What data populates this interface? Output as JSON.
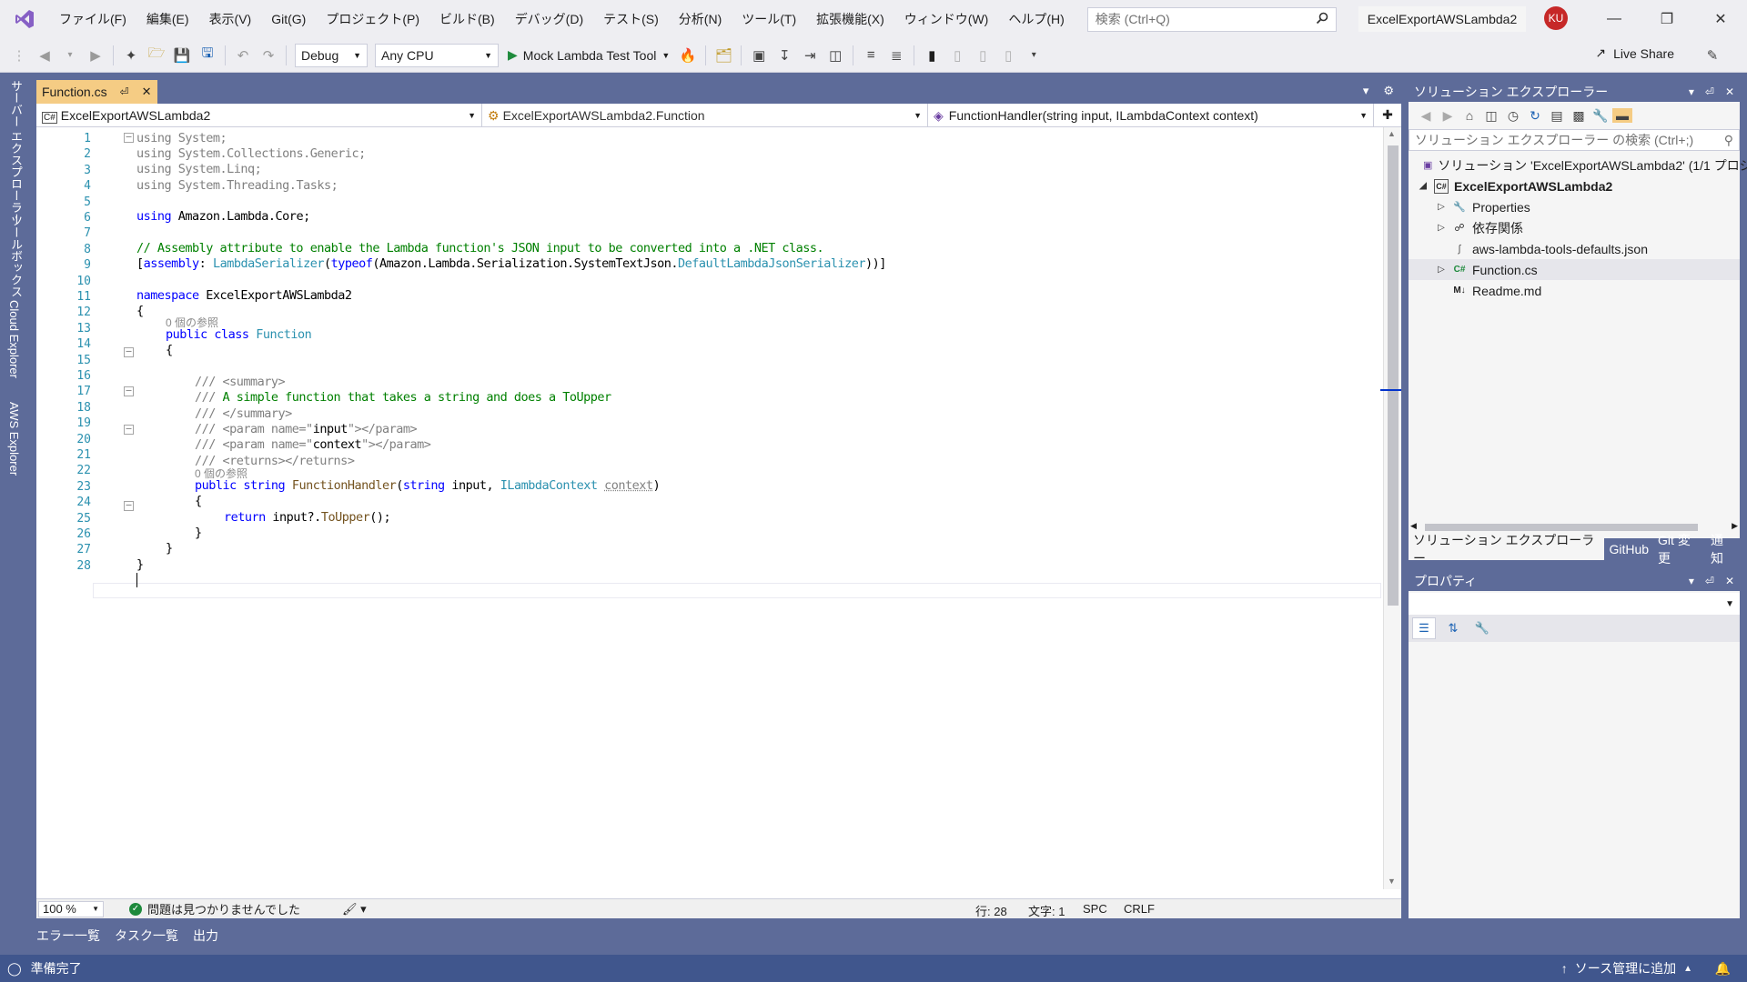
{
  "menu": {
    "items": [
      "ファイル(F)",
      "編集(E)",
      "表示(V)",
      "Git(G)",
      "プロジェクト(P)",
      "ビルド(B)",
      "デバッグ(D)",
      "テスト(S)",
      "分析(N)",
      "ツール(T)",
      "拡張機能(X)",
      "ウィンドウ(W)",
      "ヘルプ(H)"
    ],
    "search_placeholder": "検索 (Ctrl+Q)",
    "window_title": "ExcelExportAWSLambda2",
    "avatar_initials": "KU"
  },
  "toolbar": {
    "configuration": "Debug",
    "platform": "Any CPU",
    "run_target": "Mock Lambda Test Tool",
    "live_share": "Live Share"
  },
  "left_tabs": [
    "サーバー エクスプローラー",
    "ツールボックス",
    "Cloud Explorer",
    "AWS Explorer"
  ],
  "editor": {
    "tab_label": "Function.cs",
    "nav": {
      "project": "ExcelExportAWSLambda2",
      "type": "ExcelExportAWSLambda2.Function",
      "member": "FunctionHandler(string input, ILambdaContext context)"
    },
    "line_numbers": [
      "1",
      "2",
      "3",
      "4",
      "5",
      "6",
      "7",
      "8",
      "9",
      "10",
      "11",
      "12",
      "13",
      "14",
      "15",
      "16",
      "17",
      "18",
      "19",
      "20",
      "21",
      "22",
      "23",
      "24",
      "25",
      "26",
      "27",
      "28"
    ],
    "ref_hint_1": "0 個の参照",
    "ref_hint_2": "0 個の参照",
    "lines": {
      "l1a": "using",
      "l1b": " System;",
      "l2a": "using",
      "l2b": " System.Collections.Generic;",
      "l3a": "using",
      "l3b": " System.Linq;",
      "l4a": "using",
      "l4b": " System.Threading.Tasks;",
      "l6a": "using",
      "l6b": " Amazon.Lambda.Core;",
      "l8": "// Assembly attribute to enable the Lambda function's JSON input to be converted into a .NET class.",
      "l9a": "[",
      "l9b": "assembly",
      "l9c": ": ",
      "l9d": "LambdaSerializer",
      "l9e": "(",
      "l9f": "typeof",
      "l9g": "(Amazon.Lambda.Serialization.SystemTextJson.",
      "l9h": "DefaultLambdaJsonSerializer",
      "l9i": "))]",
      "l11a": "namespace",
      "l11b": " ExcelExportAWSLambda2",
      "l12": "{",
      "l13a": "public",
      "l13b": " ",
      "l13c": "class",
      "l13d": " ",
      "l13e": "Function",
      "l14": "{",
      "l16a": "/// ",
      "l16b": "<summary>",
      "l17a": "/// ",
      "l17b": "A simple function that takes a string and does a ToUpper",
      "l18a": "/// ",
      "l18b": "</summary>",
      "l19a": "/// ",
      "l19b": "<param name=\"",
      "l19c": "input",
      "l19d": "\"></param>",
      "l20a": "/// ",
      "l20b": "<param name=\"",
      "l20c": "context",
      "l20d": "\"></param>",
      "l21a": "/// ",
      "l21b": "<returns></returns>",
      "l22a": "public",
      "l22b": " ",
      "l22c": "string",
      "l22d": " ",
      "l22e": "FunctionHandler",
      "l22f": "(",
      "l22g": "string",
      "l22h": " input, ",
      "l22i": "ILambdaContext",
      "l22j": " ",
      "l22k": "context",
      "l22l": ")",
      "l23": "{",
      "l24a": "return",
      "l24b": " input?.",
      "l24c": "ToUpper",
      "l24d": "();",
      "l25": "}",
      "l26": "}",
      "l27": "}"
    },
    "status": {
      "zoom": "100 %",
      "issues": "問題は見つかりませんでした",
      "line": "行: 28",
      "col": "文字: 1",
      "spc": "SPC",
      "eol": "CRLF"
    }
  },
  "bottom_tabs": [
    "エラー一覧",
    "タスク一覧",
    "出力"
  ],
  "statusbar": {
    "ready": "準備完了",
    "source_control": "ソース管理に追加"
  },
  "solution_explorer": {
    "title": "ソリューション エクスプローラー",
    "search_placeholder": "ソリューション エクスプローラー の検索 (Ctrl+;)",
    "solution": "ソリューション 'ExcelExportAWSLambda2' (1/1 プロジェ",
    "project": "ExcelExportAWSLambda2",
    "items": [
      "Properties",
      "依存関係",
      "aws-lambda-tools-defaults.json",
      "Function.cs",
      "Readme.md"
    ],
    "bottom_tabs": [
      "ソリューション エクスプローラー",
      "GitHub",
      "Git 変更",
      "通知"
    ]
  },
  "properties": {
    "title": "プロパティ"
  },
  "colors": {
    "chrome": "#5d6b99",
    "statusbar": "#40568d",
    "tab_active": "#f5cc84",
    "keyword": "#0000ff",
    "type": "#2b91af",
    "comment": "#008000"
  }
}
